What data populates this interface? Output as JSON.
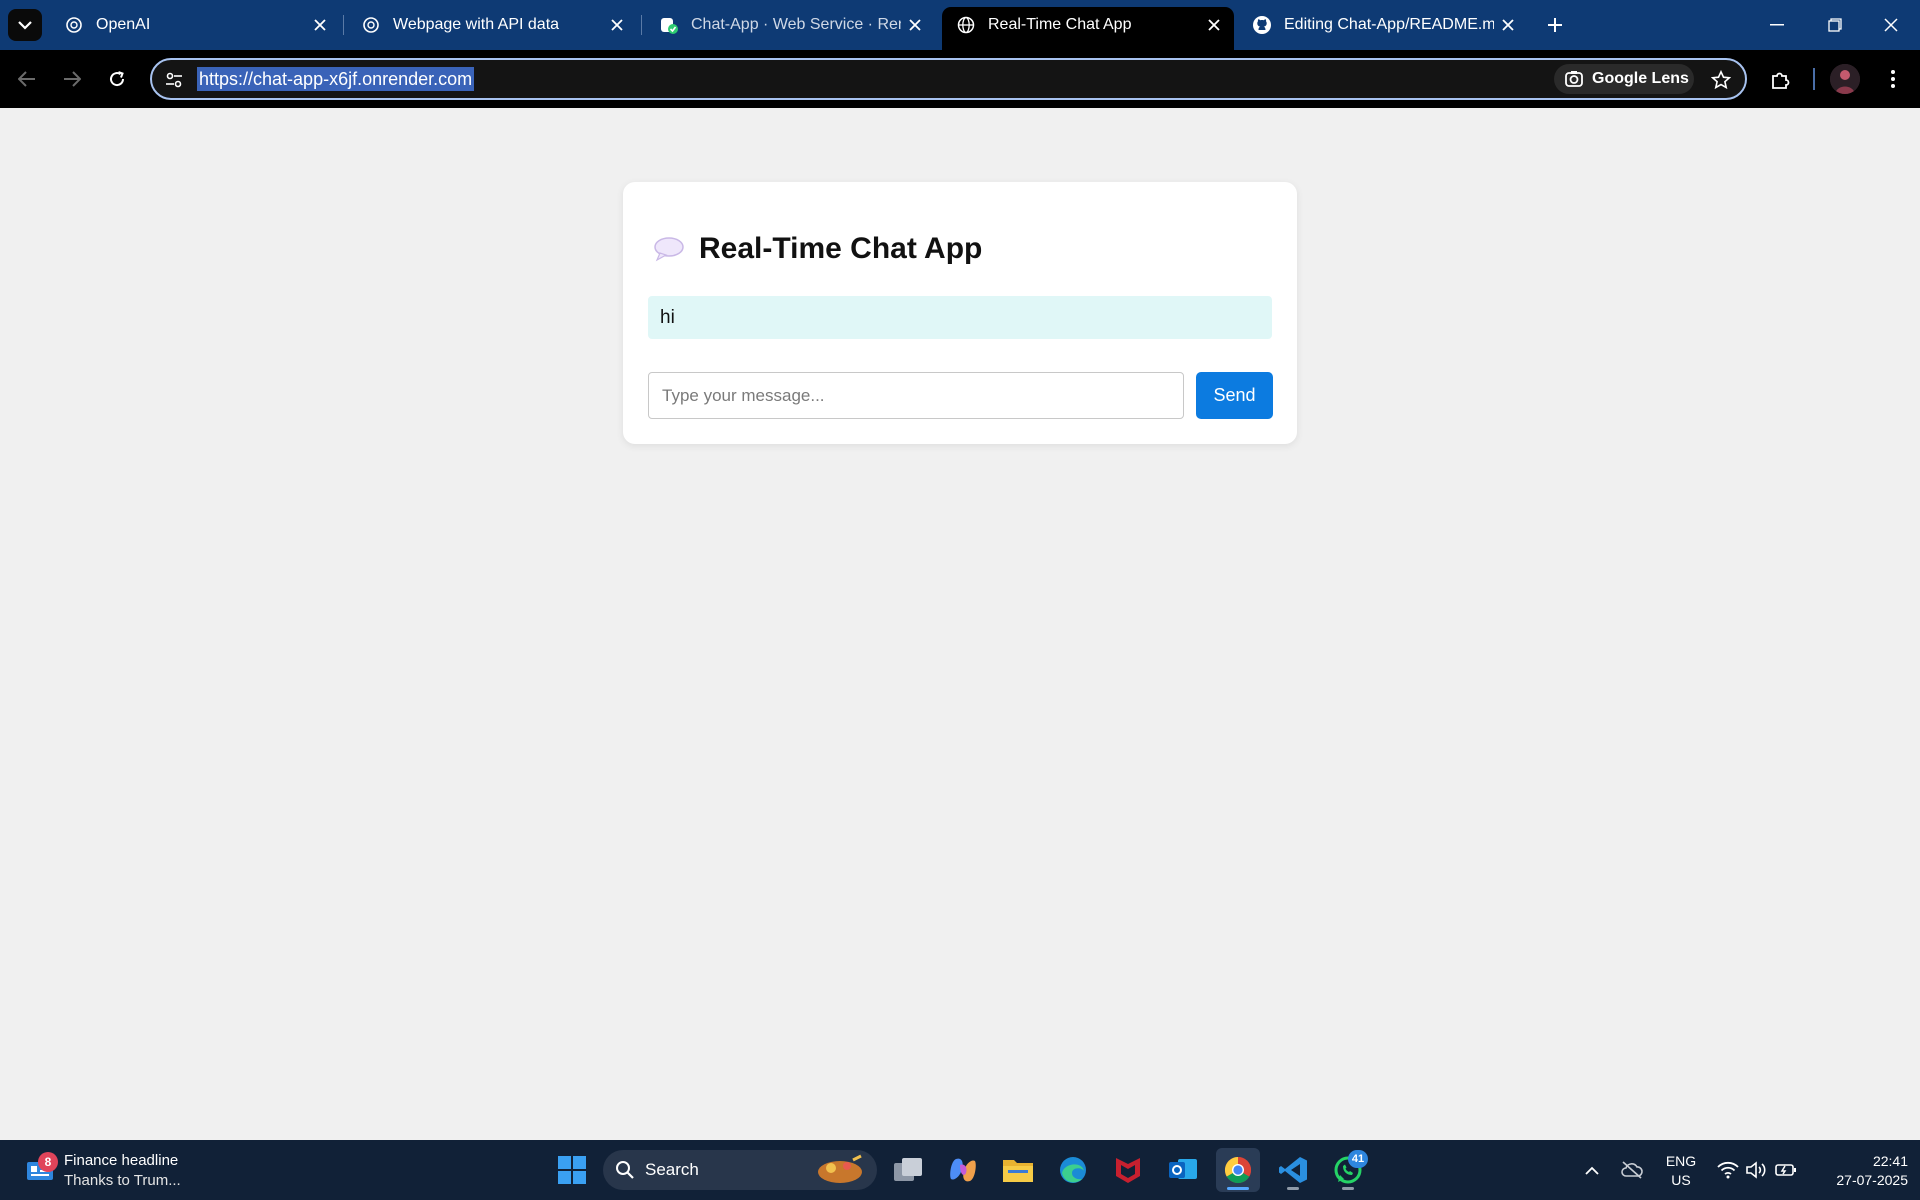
{
  "browser": {
    "tabs": [
      {
        "title": "OpenAI",
        "icon": "openai-logo-icon",
        "active": false
      },
      {
        "title": "Webpage with API data",
        "icon": "openai-logo-icon",
        "active": false
      },
      {
        "title": "Chat-App · Web Service · Rend",
        "icon": "render-logo-icon",
        "active": false
      },
      {
        "title": "Real-Time Chat App",
        "icon": "globe-icon",
        "active": true
      },
      {
        "title": "Editing Chat-App/README.md",
        "icon": "github-logo-icon",
        "active": false
      }
    ],
    "url": "https://chat-app-x6jf.onrender.com",
    "lens_label": "Google Lens",
    "colors": {
      "tabstrip": "#0e3a74",
      "toolbar": "#000000",
      "url_highlight": "#3a63b8"
    }
  },
  "app": {
    "title": "Real-Time Chat App",
    "title_emoji": "speech-balloon-icon",
    "messages": [
      "hi"
    ],
    "input_placeholder": "Type your message...",
    "input_value": "",
    "send_label": "Send",
    "colors": {
      "page_bg": "#f0f0f0",
      "message_bg": "#e0f7f7",
      "send_button": "#0c7be0"
    }
  },
  "taskbar": {
    "news": {
      "badge": "8",
      "title": "Finance headline",
      "subtitle": "Thanks to Trum..."
    },
    "search_label": "Search",
    "apps": [
      "windows-start-icon",
      "task-view-icon",
      "copilot-icon",
      "file-explorer-icon",
      "edge-icon",
      "mcafee-icon",
      "outlook-icon",
      "chrome-icon",
      "vscode-icon",
      "whatsapp-icon"
    ],
    "whatsapp_badge": "41",
    "lang_line1": "ENG",
    "lang_line2": "US",
    "time": "22:41",
    "date": "27-07-2025"
  }
}
